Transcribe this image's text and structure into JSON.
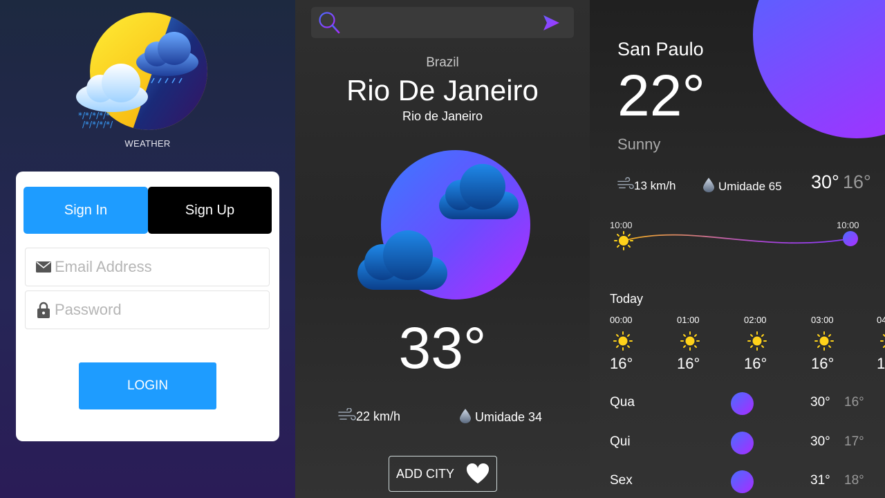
{
  "login": {
    "app_caption": "WEATHER",
    "tab_signin": "Sign In",
    "tab_signup": "Sign Up",
    "email_placeholder": "Email Address",
    "password_placeholder": "Password",
    "login_button": "LOGIN"
  },
  "city": {
    "country": "Brazil",
    "name": "Rio De Janeiro",
    "state": "Rio de Janeiro",
    "temperature": "33°",
    "wind": "22 km/h",
    "humidity": "Umidade 34",
    "add_city": "ADD CITY"
  },
  "detail": {
    "city": "San Paulo",
    "temperature": "22°",
    "condition": "Sunny",
    "wind": "13 km/h",
    "humidity": "Umidade 65",
    "high": "30°",
    "low": "16°",
    "sunrise": "10:00",
    "sunset": "10:00",
    "today_label": "Today",
    "hourly": [
      {
        "time": "00:00",
        "temp": "16°"
      },
      {
        "time": "01:00",
        "temp": "16°"
      },
      {
        "time": "02:00",
        "temp": "16°"
      },
      {
        "time": "03:00",
        "temp": "16°"
      },
      {
        "time": "04",
        "temp": "1"
      }
    ],
    "daily": [
      {
        "day": "Qua",
        "high": "30°",
        "low": "16°"
      },
      {
        "day": "Qui",
        "high": "30°",
        "low": "17°"
      },
      {
        "day": "Sex",
        "high": "31°",
        "low": "18°"
      }
    ]
  },
  "colors": {
    "accent_blue": "#1e9cff",
    "gradient_start": "#4a6cff",
    "gradient_end": "#a92cff",
    "sun": "#ffd21a"
  },
  "icons": [
    "weather-logo-icon",
    "mail-icon",
    "lock-icon",
    "search-icon",
    "send-icon",
    "cloud-icon",
    "wind-icon",
    "drop-icon",
    "heart-icon",
    "sun-icon"
  ]
}
